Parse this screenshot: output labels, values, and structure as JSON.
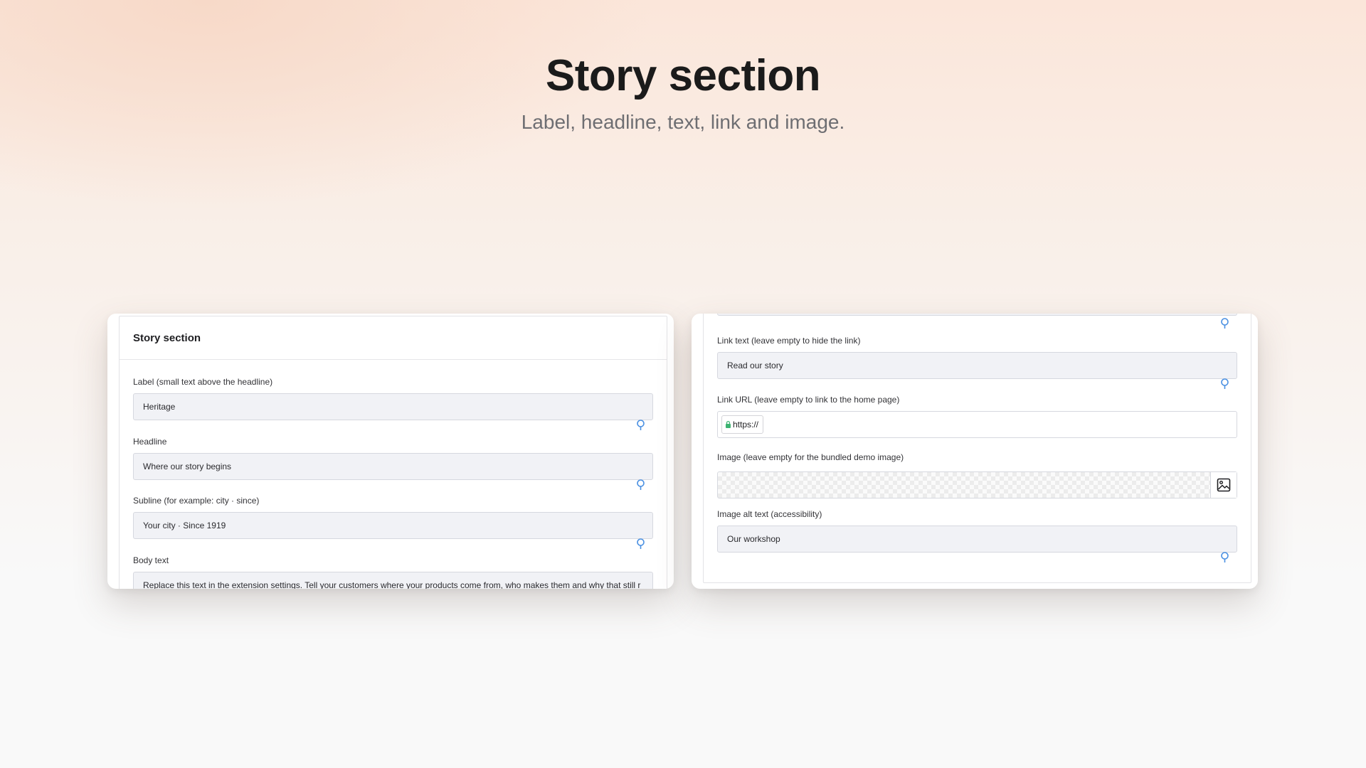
{
  "hero": {
    "title": "Story section",
    "subtitle": "Label, headline, text, link and image."
  },
  "left_panel": {
    "title": "Story section",
    "fields": [
      {
        "label": "Label (small text above the headline)",
        "value": "Heritage"
      },
      {
        "label": "Headline",
        "value": "Where our story begins"
      },
      {
        "label": "Subline (for example: city · since)",
        "value": "Your city · Since 1919"
      },
      {
        "label": "Body text",
        "value": "Replace this text in the extension settings. Tell your customers where your products come from, who makes them and why that still r"
      }
    ]
  },
  "right_panel": {
    "link_text": {
      "label": "Link text (leave empty to hide the link)",
      "value": "Read our story"
    },
    "link_url": {
      "label": "Link URL (leave empty to link to the home page)",
      "prefix": "https://",
      "value": ""
    },
    "image": {
      "label": "Image (leave empty for the bundled demo image)",
      "button_icon": "image-icon"
    },
    "image_alt": {
      "label": "Image alt text (accessibility)",
      "value": "Our workshop"
    }
  },
  "colors": {
    "accent_icon": "#4a90e2",
    "lock": "#3cb371",
    "input_bg": "#f1f2f6"
  }
}
